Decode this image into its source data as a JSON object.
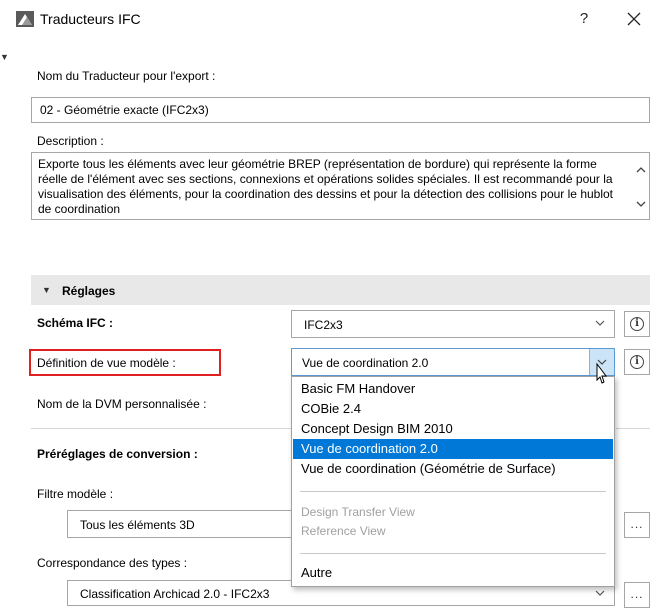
{
  "window": {
    "title": "Traducteurs IFC",
    "help_label": "?",
    "close_label": "✕"
  },
  "translator": {
    "name_label": "Nom du Traducteur pour l'export :",
    "name_value": "02 - Géométrie exacte (IFC2x3)",
    "description_label": "Description :",
    "description_text": "Exporte tous les éléments avec leur géométrie BREP (représentation de bordure) qui représente la forme réelle de l'élément avec ses sections, connexions et opérations solides spéciales. Il est recommandé pour la visualisation des éléments, pour la coordination des dessins et pour la détection des collisions pour le hublot de coordination"
  },
  "settings": {
    "section_label": "Réglages",
    "schema_label": "Schéma IFC :",
    "schema_value": "IFC2x3",
    "mvd_label": "Définition de vue modèle :",
    "mvd_value": "Vue de coordination 2.0",
    "custom_mvd_label": "Nom de la DVM personnalisée :",
    "presets_label": "Préréglages de conversion :",
    "filter_label": "Filtre modèle :",
    "filter_value": "Tous les éléments 3D",
    "types_label": "Correspondance des types :",
    "types_value": "Classification Archicad 2.0 - IFC2x3",
    "more_label": "..."
  },
  "dropdown": {
    "items": [
      {
        "label": "Basic FM Handover"
      },
      {
        "label": "COBie 2.4"
      },
      {
        "label": "Concept Design BIM 2010"
      },
      {
        "label": "Vue de coordination 2.0",
        "selected": true
      },
      {
        "label": "Vue de coordination (Géométrie de Surface)"
      },
      {
        "label": "Design Transfer View",
        "disabled": true
      },
      {
        "label": "Reference View",
        "disabled": true
      },
      {
        "label": "Autre"
      }
    ]
  },
  "colors": {
    "accent": "#0078d7",
    "highlight_border": "#e02020"
  }
}
